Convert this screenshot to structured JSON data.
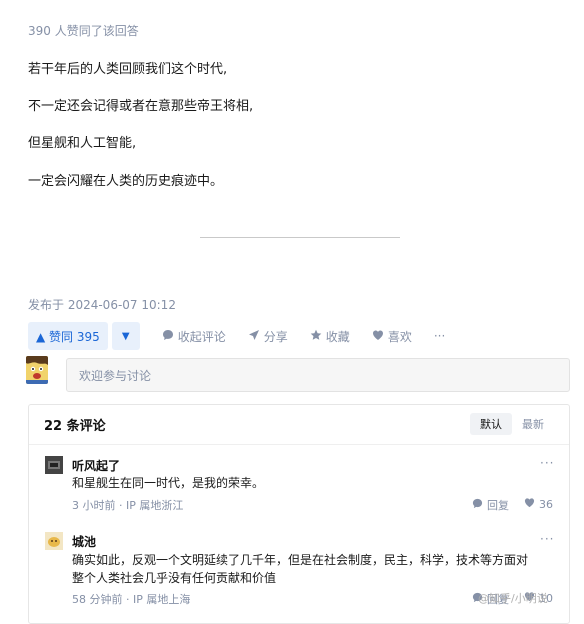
{
  "answer": {
    "approve_line": "390 人赞同了该回答",
    "paragraphs": [
      "若干年后的人类回顾我们这个时代,",
      "不一定还会记得或者在意那些帝王将相,",
      "但星舰和人工智能,",
      "一定会闪耀在人类的历史痕迹中。"
    ],
    "published": "发布于 2024-06-07 10:12"
  },
  "actions": {
    "upvote_label": "▲ 赞同 395",
    "downvote_label": "▼",
    "collapse_comments": "收起评论",
    "share": "分享",
    "favorite": "收藏",
    "like": "喜欢",
    "more": "···"
  },
  "comment_input": {
    "placeholder": "欢迎参与讨论"
  },
  "comments_panel": {
    "title": "22 条评论",
    "sort_default": "默认",
    "sort_latest": "最新",
    "items": [
      {
        "author": "听风起了",
        "text": "和星舰生在同一时代，是我的荣幸。",
        "meta": "3 小时前 · IP 属地浙江",
        "reply": "回复",
        "likes": "36",
        "more": "···"
      },
      {
        "author": "城池",
        "text_lines": [
          "确实如此，反观一个文明延续了几千年，但是在社会制度，民主，科学，技术等方面对",
          "整个人类社会几乎没有任何贡献和价值"
        ],
        "meta": "58 分钟前 · IP 属地上海",
        "reply": "回复",
        "likes": "10",
        "more": "···"
      }
    ]
  },
  "watermark": "@知乎/小明说",
  "icons": {
    "comment": "comment-icon",
    "share": "share-icon",
    "favorite": "star-icon",
    "like": "heart-icon",
    "reply": "reply-icon"
  },
  "colors": {
    "accent": "#1a66d6",
    "accent_bg": "#e8f0fb",
    "muted": "#8590a6"
  }
}
